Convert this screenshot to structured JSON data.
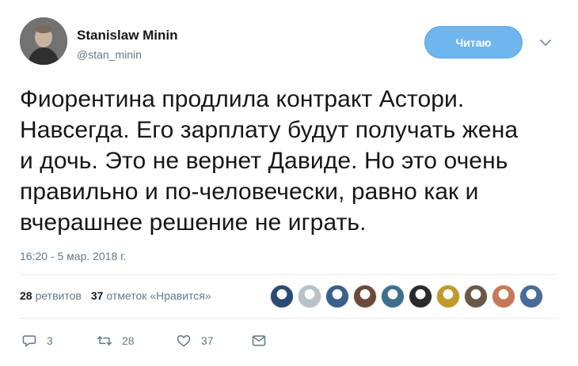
{
  "author": {
    "name": "Stanislaw Minin",
    "handle": "@stan_minin"
  },
  "follow_button": {
    "label": "Читаю"
  },
  "tweet": {
    "lines": [
      "Фиорентина продлила контракт Астори.",
      "Навсегда. Его зарплату будут получать жена",
      "и дочь. Это не вернет Давиде. Но это очень",
      "правильно и по-человечески, равно как и",
      "вчерашнее решение не играть."
    ],
    "timestamp": "16:20 - 5 мар. 2018 г."
  },
  "stats": {
    "retweets_count": "28",
    "retweets_label": "ретвитов",
    "likes_count": "37",
    "likes_label": "отметок «Нравится»"
  },
  "likers": {
    "colors": [
      "#2b4a74",
      "#b9c1c8",
      "#3a5f8a",
      "#6b4a3a",
      "#3d6f8f",
      "#2a2a2a",
      "#c09a2a",
      "#6a5848",
      "#c87858",
      "#4a6a9a"
    ]
  },
  "actions": {
    "reply_count": "3",
    "retweet_count": "28",
    "like_count": "37"
  },
  "colors": {
    "accent": "#1da1f2",
    "muted": "#657786",
    "text": "#14171a"
  }
}
